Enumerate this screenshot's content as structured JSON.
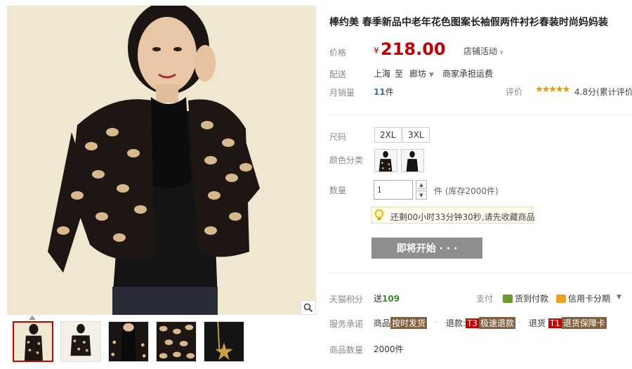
{
  "product": {
    "title": "棒约美 春季新品中老年花色图案长袖假两件衬衫春装时尚妈妈装",
    "price_label": "价格",
    "currency_symbol": "¥",
    "price": "218.00",
    "shop_activity": "店铺活动"
  },
  "delivery": {
    "label": "配送",
    "from": "上海",
    "to_word": "至",
    "destination": "廊坊",
    "freight": "商家承担运费"
  },
  "sales": {
    "label": "月销量",
    "count": "11",
    "unit": "件",
    "rating_label": "评价",
    "stars": "★★★★★",
    "score": "4.8分(累计评价",
    "star_color": "#e89a00"
  },
  "options": {
    "size_label": "尺码",
    "sizes": [
      "2XL",
      "3XL"
    ],
    "color_label": "颜色分类",
    "quantity_label": "数量",
    "quantity_value": "1",
    "stock_text": "件 (库存2000件)"
  },
  "tip": {
    "text": "还剩00小时33分钟30秒,请先收藏商品"
  },
  "action": {
    "coming_button": "即将开始 · · ·"
  },
  "tmall_points": {
    "label": "天猫积分",
    "prefix": "送",
    "value": "109"
  },
  "payment": {
    "label": "支付",
    "cod": "货到付款",
    "installment": "信用卡分期"
  },
  "service": {
    "label": "服务承诺",
    "item_word": "商品",
    "item_tag": "按时发货",
    "refund_word": "退款",
    "refund_t": "T3",
    "refund_tag": "极速退款",
    "return_word": "退货",
    "return_t": "T1",
    "return_tag": "退货保障卡"
  },
  "quantity_sold": {
    "label": "商品数量",
    "value": "2000件"
  },
  "colors": {
    "price_red": "#c40000",
    "disabled_button": "#8e8e8e",
    "points_green": "#3a8a2a",
    "tag_brown": "#80613c"
  }
}
